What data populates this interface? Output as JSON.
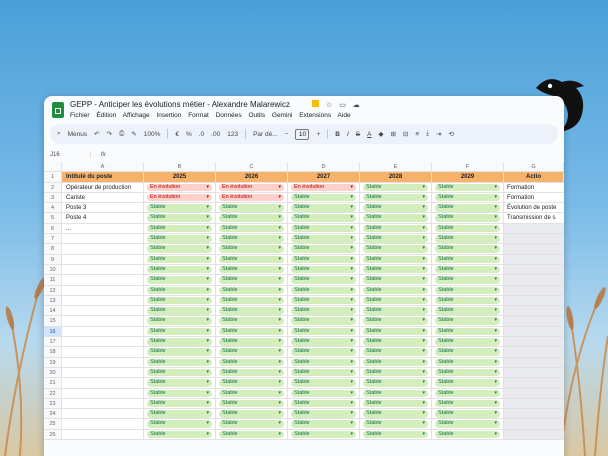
{
  "colors": {
    "header_fill": "#f6b26b",
    "stable_chip": "#d4edbc",
    "stable_text": "#11734b",
    "evolution_chip": "#ffcfc9",
    "evolution_text": "#b10202",
    "sheets_green": "#1e8e3e"
  },
  "window": {
    "title": "GEPP - Anticiper les évolutions métier - Alexandre Malarewicz",
    "menu": [
      "Fichier",
      "Édition",
      "Affichage",
      "Insertion",
      "Format",
      "Données",
      "Outils",
      "Gemini",
      "Extensions",
      "Aide"
    ]
  },
  "toolbar": {
    "menus_label": "Menus",
    "zoom": "100%",
    "currency": "€",
    "percent": "%",
    "decimals_less": ".0",
    "decimals_more": ".00",
    "number_format": "123",
    "font": "Par dé...",
    "font_size": "10",
    "bold": "B",
    "italic": "I",
    "strike": "S",
    "text_color": "A"
  },
  "formula_bar": {
    "cell_ref": "J16",
    "fx": "fx"
  },
  "sheet": {
    "col_letters": [
      "A",
      "B",
      "C",
      "D",
      "E",
      "F",
      "G"
    ],
    "headers": {
      "label": "Intitulé du poste",
      "years": [
        "2025",
        "2026",
        "2027",
        "2028",
        "2029"
      ],
      "action": "Actio"
    },
    "row_numbers": [
      "1",
      "2",
      "3",
      "4",
      "5",
      "6",
      "7",
      "8",
      "9",
      "10",
      "11",
      "12",
      "13",
      "14",
      "15",
      "16",
      "17",
      "18",
      "19",
      "20",
      "21",
      "22",
      "23",
      "24",
      "25",
      "26"
    ],
    "selected_row": "16",
    "rows": [
      {
        "poste": "Opérateur de production",
        "status": [
          "En évolution",
          "En évolution",
          "En évolution",
          "Stable",
          "Stable"
        ],
        "action": "Formation"
      },
      {
        "poste": "Cariste",
        "status": [
          "En évolution",
          "En évolution",
          "Stable",
          "Stable",
          "Stable"
        ],
        "action": "Formation"
      },
      {
        "poste": "Poste 3",
        "status": [
          "Stable",
          "Stable",
          "Stable",
          "Stable",
          "Stable"
        ],
        "action": "Évolution de poste"
      },
      {
        "poste": "Poste 4",
        "status": [
          "Stable",
          "Stable",
          "Stable",
          "Stable",
          "Stable"
        ],
        "action": "Transmission de s"
      },
      {
        "poste": "...",
        "status": [
          "Stable",
          "Stable",
          "Stable",
          "Stable",
          "Stable"
        ],
        "action": ""
      }
    ],
    "empty_row_status": "Stable"
  }
}
